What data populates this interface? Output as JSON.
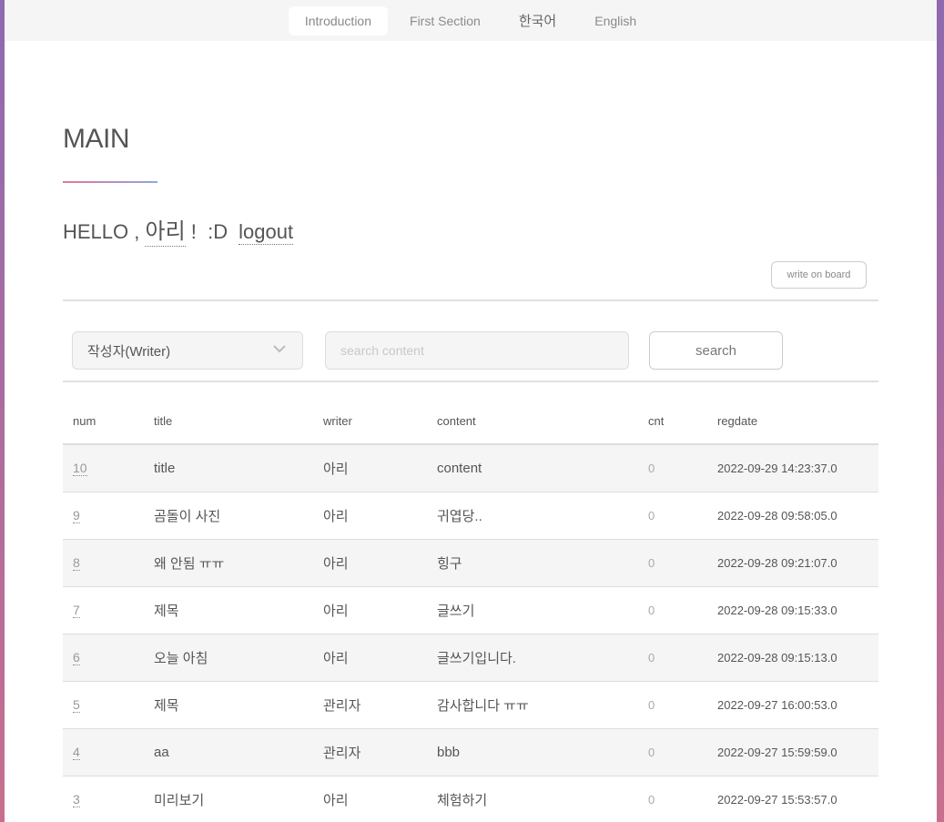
{
  "nav": {
    "items": [
      {
        "label": "Introduction"
      },
      {
        "label": "First Section"
      },
      {
        "label": "한국어"
      },
      {
        "label": "English"
      }
    ]
  },
  "main": {
    "title": "MAIN",
    "greeting_prefix": "HELLO , ",
    "username": "아리",
    "greeting_suffix": " !  :D",
    "logout_label": "logout",
    "write_label": "write on board"
  },
  "search": {
    "select_value": "작성자(Writer)",
    "placeholder": "search content",
    "button_label": "search"
  },
  "table": {
    "columns": [
      "num",
      "title",
      "writer",
      "content",
      "cnt",
      "regdate"
    ],
    "rows": [
      {
        "num": "10",
        "title": "title",
        "writer": "아리",
        "content": "content",
        "cnt": "0",
        "regdate": "2022-09-29 14:23:37.0"
      },
      {
        "num": "9",
        "title": "곰돌이 사진",
        "writer": "아리",
        "content": "귀엽당..",
        "cnt": "0",
        "regdate": "2022-09-28 09:58:05.0"
      },
      {
        "num": "8",
        "title": "왜 안됨 ㅠㅠ",
        "writer": "아리",
        "content": "힝구",
        "cnt": "0",
        "regdate": "2022-09-28 09:21:07.0"
      },
      {
        "num": "7",
        "title": "제목",
        "writer": "아리",
        "content": "글쓰기",
        "cnt": "0",
        "regdate": "2022-09-28 09:15:33.0"
      },
      {
        "num": "6",
        "title": "오늘 아침",
        "writer": "아리",
        "content": "글쓰기입니다.",
        "cnt": "0",
        "regdate": "2022-09-28 09:15:13.0"
      },
      {
        "num": "5",
        "title": "제목",
        "writer": "관리자",
        "content": "감사합니다 ㅠㅠ",
        "cnt": "0",
        "regdate": "2022-09-27 16:00:53.0"
      },
      {
        "num": "4",
        "title": "aa",
        "writer": "관리자",
        "content": "bbb",
        "cnt": "0",
        "regdate": "2022-09-27 15:59:59.0"
      },
      {
        "num": "3",
        "title": "미리보기",
        "writer": "아리",
        "content": "체험하기",
        "cnt": "0",
        "regdate": "2022-09-27 15:53:57.0"
      }
    ]
  }
}
